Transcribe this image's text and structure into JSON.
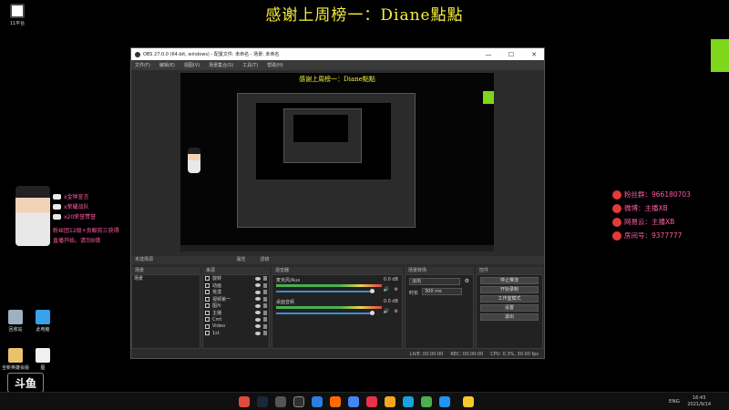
{
  "banner": {
    "title": "感谢上周榜一：Diane點點"
  },
  "desktop": {
    "top_icon_label": "11平台",
    "icons": [
      {
        "label": "回收站"
      },
      {
        "label": "此电脑"
      },
      {
        "label": "全新英雄会版"
      },
      {
        "label": "图"
      }
    ],
    "logo": "斗鱼"
  },
  "gifts": {
    "rows": [
      {
        "text": "x金钟宣言"
      },
      {
        "text": "x荣耀战队"
      },
      {
        "text": "x20荣誉赞誉"
      }
    ],
    "message_lines": [
      "粉丝团12级+贡献前三获得",
      "直播开始，请勿B错"
    ]
  },
  "social": {
    "rows": [
      {
        "text": "粉丝群：966180703"
      },
      {
        "text": "微博：主播XB"
      },
      {
        "text": "网易云：主播XB"
      },
      {
        "text": "房间号：9377777"
      }
    ]
  },
  "obs": {
    "window_title": "OBS 27.0.0 (64-bit, windows) - 配置文件: 未命名 - 场景: 未命名",
    "win_buttons": [
      "—",
      "☐",
      "✕"
    ],
    "menu": [
      "文件(F)",
      "编辑(E)",
      "视图(V)",
      "场景集合(S)",
      "工具(T)",
      "帮助(H)"
    ],
    "preview_title": "感谢上周榜一：Diane點點",
    "scene_strip": {
      "label": "未选择源",
      "props": "属性",
      "filters": "滤镜"
    },
    "panels": {
      "scenes": {
        "header": "场景",
        "items": [
          "场景"
        ]
      },
      "sources": {
        "header": "来源",
        "items": [
          "旋转",
          "动画",
          "荒漠",
          "视频第一",
          "图片",
          "主播",
          "Cmt",
          "Video",
          "1st"
        ]
      },
      "mixer": {
        "header": "混音器",
        "tracks": [
          {
            "name": "麦克风/Aux",
            "db": "0.0 dB"
          },
          {
            "name": "桌面音频",
            "db": "0.0 dB"
          }
        ]
      },
      "transitions": {
        "header": "场景转场",
        "type": "淡出",
        "duration_label": "时长",
        "duration_value": "300 ms"
      },
      "controls": {
        "header": "控件",
        "buttons": [
          "停止推流",
          "开始录制",
          "工作室模式",
          "设置",
          "退出"
        ]
      }
    },
    "status": {
      "live": "LIVE: 00:00:00",
      "rec": "REC: 00:00:00",
      "cpu": "CPU: 0.3%, 30.00 fps"
    }
  },
  "taskbar": {
    "tray_lang": "ENG",
    "time": "16:43",
    "date": "2021/9/14"
  },
  "colors": {
    "accent_yellow": "#f7f13a",
    "pink": "#ff5da2",
    "green": "#7fd61a"
  }
}
